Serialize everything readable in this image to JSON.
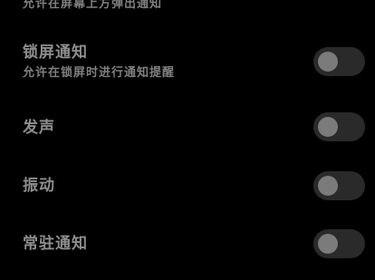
{
  "settings": [
    {
      "title": "",
      "description": "允许在屏幕上方弹出通知",
      "toggle_on": false
    },
    {
      "title": "锁屏通知",
      "description": "允许在锁屏时进行通知提醒",
      "toggle_on": false
    },
    {
      "title": "发声",
      "toggle_on": false
    },
    {
      "title": "振动",
      "toggle_on": false
    },
    {
      "title": "常驻通知",
      "toggle_on": false
    }
  ],
  "colors": {
    "background": "#000000",
    "text": "#8e8e8e",
    "toggle_track": "#2a2a2a",
    "toggle_knob": "#7b7b7b"
  }
}
